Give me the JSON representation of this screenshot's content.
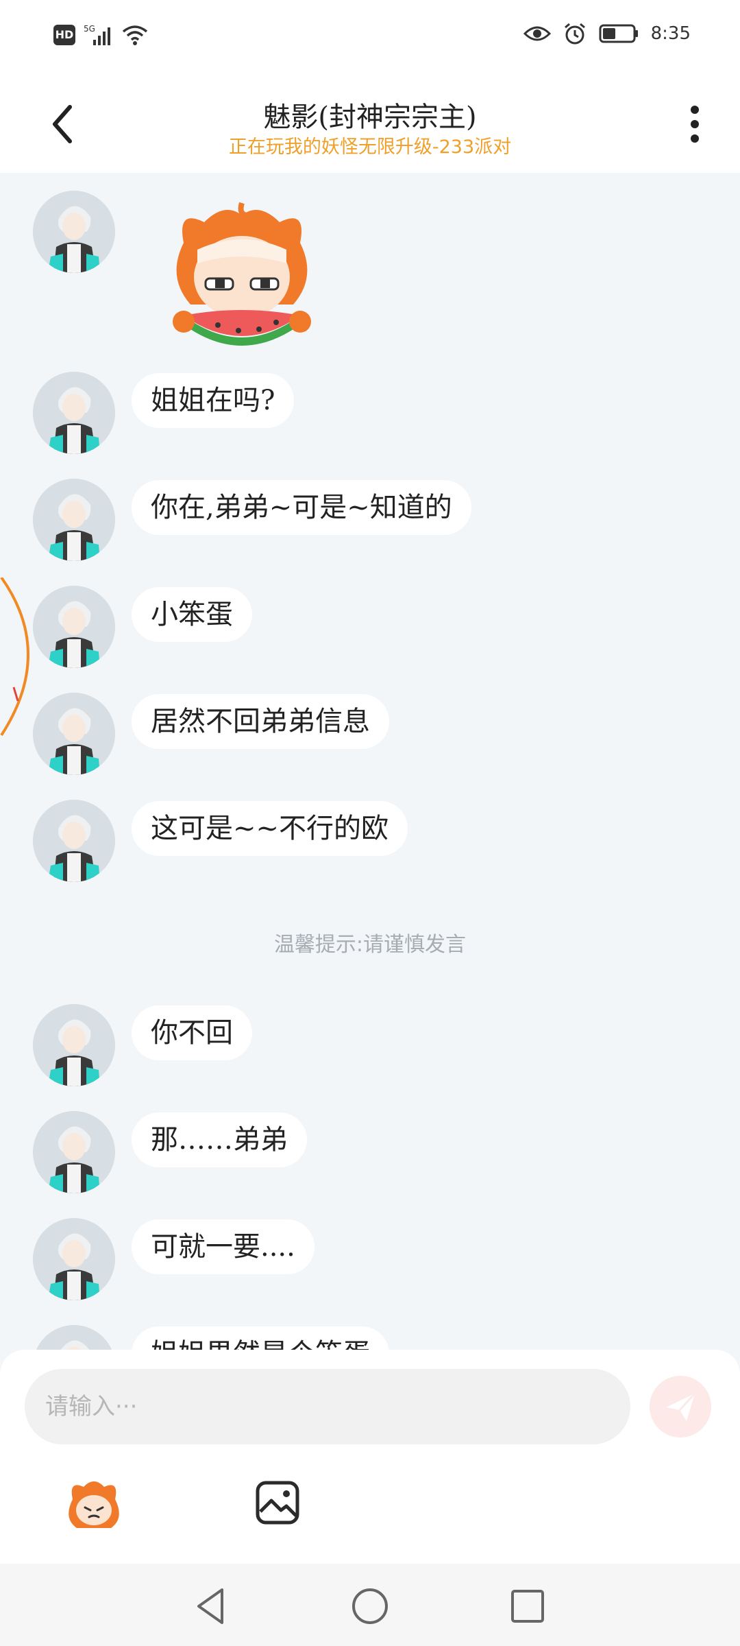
{
  "status_bar": {
    "hd": "HD",
    "network": "5G",
    "time": "8:35"
  },
  "header": {
    "title": "魅影(封神宗宗主)",
    "subtitle": "正在玩我的妖怪无限升级-233派对"
  },
  "messages": [
    {
      "type": "sticker",
      "sticker": "watermelon-eating-character"
    },
    {
      "type": "text",
      "text": "姐姐在吗?"
    },
    {
      "type": "text",
      "text": "你在,弟弟~可是~知道的"
    },
    {
      "type": "text",
      "text": "小笨蛋"
    },
    {
      "type": "text",
      "text": "居然不回弟弟信息"
    },
    {
      "type": "text",
      "text": "这可是~~不行的欧"
    },
    {
      "type": "text",
      "text": "你不回"
    },
    {
      "type": "text",
      "text": "那……弟弟"
    },
    {
      "type": "text",
      "text": "可就一要...."
    },
    {
      "type": "text",
      "text": "姐姐果然是个笨蛋"
    }
  ],
  "hint": "温馨提示:请谨慎发言",
  "input": {
    "placeholder": "请输入···",
    "value": ""
  },
  "toolbar": {
    "emoji_icon": "emoji-sticker-icon",
    "image_icon": "image-icon"
  },
  "colors": {
    "accent_orange": "#f0a02a",
    "background": "#f3f6f9",
    "send_button": "#fde9e7"
  }
}
